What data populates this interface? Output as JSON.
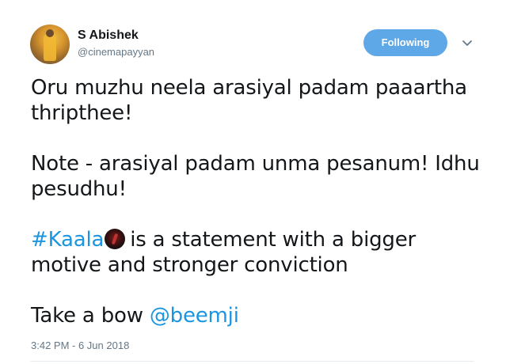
{
  "author": {
    "name": "S Abishek",
    "handle": "@cinemapayyan"
  },
  "follow_button": {
    "label": "Following"
  },
  "tweet": {
    "line1": "Oru muzhu neela arasiyal padam paaartha thripthee!",
    "line2": "Note - arasiyal padam unma pesanum! Idhu pesudhu!",
    "hashtag": "#Kaala",
    "line3_rest": "is a statement with a bigger motive and stronger conviction",
    "line4_text": "Take a bow",
    "mention": "@beemji"
  },
  "timestamp": "3:42 PM - 6 Jun 2018",
  "colors": {
    "link": "#1b95e0",
    "follow_button": "#5fa8e8",
    "secondary_text": "#657786"
  },
  "icons": {
    "menu": "chevron-down-icon",
    "emoji": "kaala-emoji-icon"
  }
}
